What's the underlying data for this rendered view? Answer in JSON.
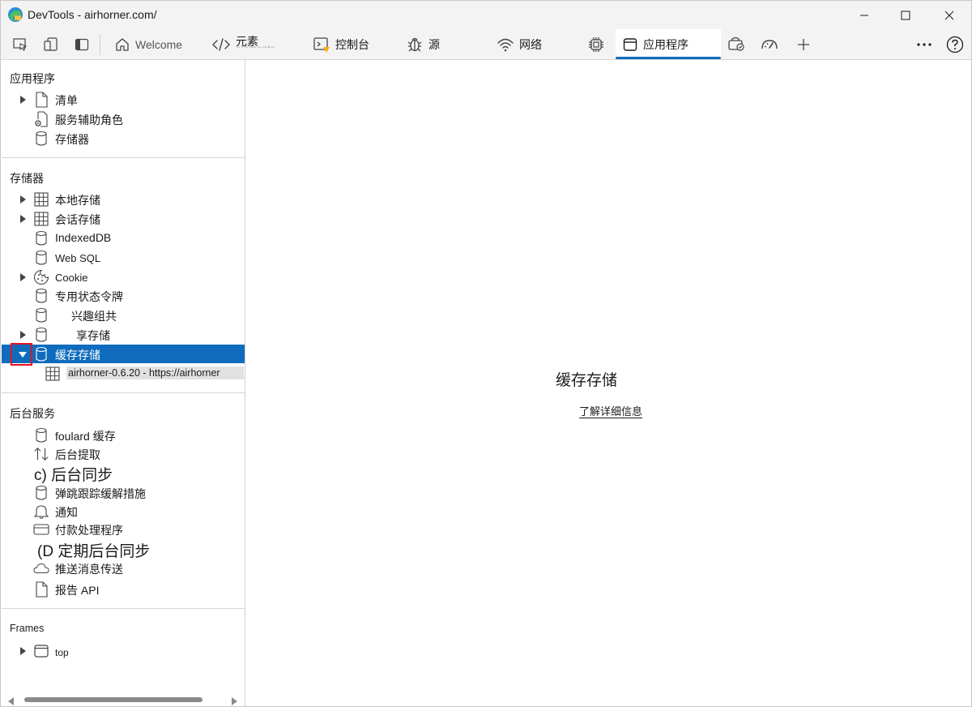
{
  "window": {
    "title": "DevTools - airhorner.com/"
  },
  "toolbar": {
    "tabs": [
      {
        "label": "Welcome"
      },
      {
        "label": "元素",
        "sublabel": "elements"
      },
      {
        "label": "控制台"
      },
      {
        "label": "源"
      },
      {
        "label": "网络"
      },
      {
        "label": "应用程序"
      }
    ],
    "icons": [
      "inspect-icon",
      "device-emulation-icon",
      "sidebar-toggle-icon",
      "performance-icon",
      "application-icon",
      "security-icon",
      "lighthouse-icon",
      "add-tab-icon",
      "more-icon",
      "help-icon"
    ]
  },
  "sidebar": {
    "application": {
      "title": "应用程序",
      "items": [
        {
          "label": "清单",
          "icon": "file-icon"
        },
        {
          "label": "服务辅助角色",
          "icon": "gear-file-icon"
        },
        {
          "label": "存储器",
          "icon": "database-icon"
        }
      ]
    },
    "storage": {
      "title": "存储器",
      "items": [
        {
          "label": "本地存储",
          "icon": "grid-icon"
        },
        {
          "label": "会话存储",
          "icon": "grid-icon"
        },
        {
          "label": "IndexedDB",
          "icon": "database-icon"
        },
        {
          "label": "Web SQL",
          "icon": "database-icon"
        },
        {
          "label": "Cookie",
          "icon": "cookie-icon"
        },
        {
          "label": "专用状态令牌",
          "icon": "database-icon"
        },
        {
          "label": "兴趣组共",
          "icon": "database-icon"
        },
        {
          "label": "享存储",
          "icon": "database-icon"
        },
        {
          "label": "缓存存储",
          "icon": "database-icon"
        }
      ],
      "cache_child": "airhorner-0.6.20 - https://airhorner"
    },
    "background": {
      "title": "后台服务",
      "items": [
        {
          "label": "foulard 缓存",
          "icon": "database-icon"
        },
        {
          "label": "后台提取",
          "icon": "arrows-icon"
        },
        {
          "label": "c) 后台同步",
          "icon": "sync-icon"
        },
        {
          "label": "弹跳跟踪缓解措施",
          "icon": "database-icon"
        },
        {
          "label": "通知",
          "icon": "bell-icon"
        },
        {
          "label": "付款处理程序",
          "icon": "card-icon"
        },
        {
          "label": "(D 定期后台同步",
          "icon": "sync-icon"
        },
        {
          "label": "推送消息传送",
          "icon": "cloud-icon"
        },
        {
          "label": "报告 API",
          "icon": "file-icon"
        }
      ]
    },
    "frames": {
      "title": "Frames",
      "items": [
        {
          "label": "top",
          "icon": "frame-icon"
        }
      ]
    }
  },
  "main": {
    "title": "缓存存储",
    "link": "了解详细信息"
  }
}
